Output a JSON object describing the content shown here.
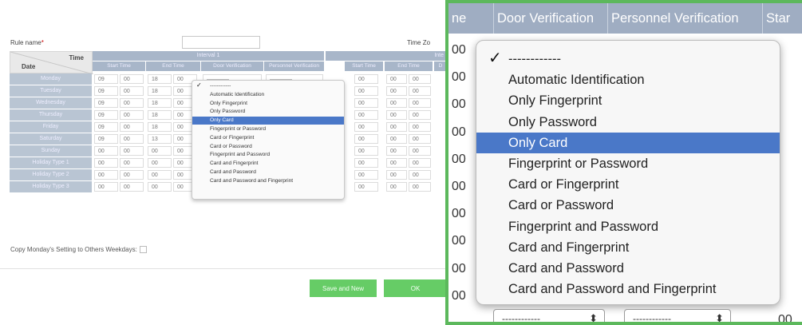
{
  "form": {
    "rule_name_label": "Rule name",
    "required_mark": "*",
    "time_zone_label": "Time Zo",
    "corner_time": "Time",
    "corner_date": "Date",
    "interval1_label": "Interval 1",
    "interval2_label": "Inte",
    "sub_headers": [
      "Start Time",
      "End Time",
      "Door Verification",
      "Personnel Verification",
      "Start Time",
      "End Time",
      "D"
    ],
    "days": [
      "Monday",
      "Tuesday",
      "Wednesday",
      "Thursday",
      "Friday",
      "Saturday",
      "Sunday",
      "Holiday Type 1",
      "Holiday Type 2",
      "Holiday Type 3"
    ],
    "rows": [
      {
        "s_h": "09",
        "s_m": "00",
        "e_h": "18",
        "e_m": "00",
        "s2_m": "00",
        "e2_h": "00",
        "e2_m": "00"
      },
      {
        "s_h": "09",
        "s_m": "00",
        "e_h": "18",
        "e_m": "00",
        "s2_m": "00",
        "e2_h": "00",
        "e2_m": "00"
      },
      {
        "s_h": "09",
        "s_m": "00",
        "e_h": "18",
        "e_m": "00",
        "s2_m": "00",
        "e2_h": "00",
        "e2_m": "00"
      },
      {
        "s_h": "09",
        "s_m": "00",
        "e_h": "18",
        "e_m": "00",
        "s2_m": "00",
        "e2_h": "00",
        "e2_m": "00"
      },
      {
        "s_h": "09",
        "s_m": "00",
        "e_h": "18",
        "e_m": "00",
        "s2_m": "00",
        "e2_h": "00",
        "e2_m": "00"
      },
      {
        "s_h": "09",
        "s_m": "00",
        "e_h": "13",
        "e_m": "00",
        "s2_m": "00",
        "e2_h": "00",
        "e2_m": "00"
      },
      {
        "s_h": "00",
        "s_m": "00",
        "e_h": "00",
        "e_m": "00",
        "s2_m": "00",
        "e2_h": "00",
        "e2_m": "00"
      },
      {
        "s_h": "00",
        "s_m": "00",
        "e_h": "00",
        "e_m": "00",
        "s2_m": "00",
        "e2_h": "00",
        "e2_m": "00"
      },
      {
        "s_h": "00",
        "s_m": "00",
        "e_h": "00",
        "e_m": "00",
        "s2_m": "00",
        "e2_h": "00",
        "e2_m": "00"
      },
      {
        "s_h": "00",
        "s_m": "00",
        "e_h": "00",
        "e_m": "00",
        "s2_m": "00",
        "e2_h": "00",
        "e2_m": "00"
      }
    ],
    "select_placeholder": "————",
    "copy_label": "Copy Monday's Setting to Others Weekdays:",
    "save_new_label": "Save and New",
    "ok_label": "OK"
  },
  "verification_options": [
    "------------",
    "Automatic Identification",
    "Only Fingerprint",
    "Only Password",
    "Only Card",
    "Fingerprint or Password",
    "Card or Fingerprint",
    "Card or Password",
    "Fingerprint and Password",
    "Card and Fingerprint",
    "Card and Password",
    "Card and Password and Fingerprint"
  ],
  "selected_option_index": 4,
  "checked_option_index": 0,
  "check_glyph": "✓",
  "zoom": {
    "headers": [
      "ne",
      "Door Verification",
      "Personnel Verification",
      "Star"
    ],
    "row_values": [
      "00",
      "00",
      "00",
      "00",
      "00",
      "00",
      "00",
      "00",
      "00",
      "00"
    ],
    "bottom_select_1": "------------",
    "bottom_select_2": "------------",
    "bottom_select_arrow": "⬍",
    "bottom_last_value": "00"
  },
  "colors": {
    "accent_green": "#5cb85c",
    "header_blue": "#9fadc2",
    "selection_blue": "#4a78c8"
  }
}
